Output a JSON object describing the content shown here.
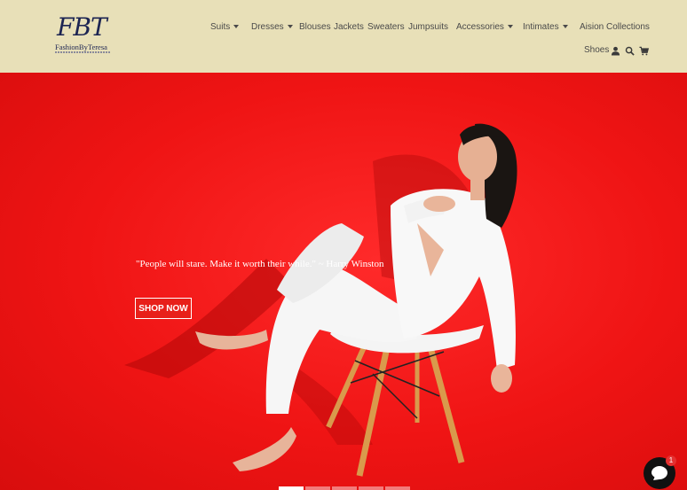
{
  "brand": {
    "monogram": "FBT",
    "name": "FashionByTeresa"
  },
  "nav": {
    "items": [
      {
        "label": "Suits",
        "dropdown": true
      },
      {
        "label": "Dresses",
        "dropdown": true
      },
      {
        "label": "Blouses",
        "dropdown": false
      },
      {
        "label": "Jackets",
        "dropdown": false
      },
      {
        "label": "Sweaters",
        "dropdown": false
      },
      {
        "label": "Jumpsuits",
        "dropdown": false
      },
      {
        "label": "Accessories",
        "dropdown": true
      },
      {
        "label": "Intimates",
        "dropdown": true
      },
      {
        "label": "Aision Collections",
        "dropdown": false
      }
    ],
    "shoes": "Shoes",
    "icons": [
      "account-icon",
      "search-icon",
      "cart-icon"
    ]
  },
  "hero": {
    "quote": "\"People will stare. Make it worth their while.\" ~ Harry Winston",
    "cta": "SHOP NOW",
    "slides": 5,
    "active_slide": 1
  },
  "chat": {
    "badge": "1"
  },
  "colors": {
    "header_bg": "#e8e0b8",
    "hero_bg": "#ef1414",
    "brand_navy": "#1c2452"
  }
}
